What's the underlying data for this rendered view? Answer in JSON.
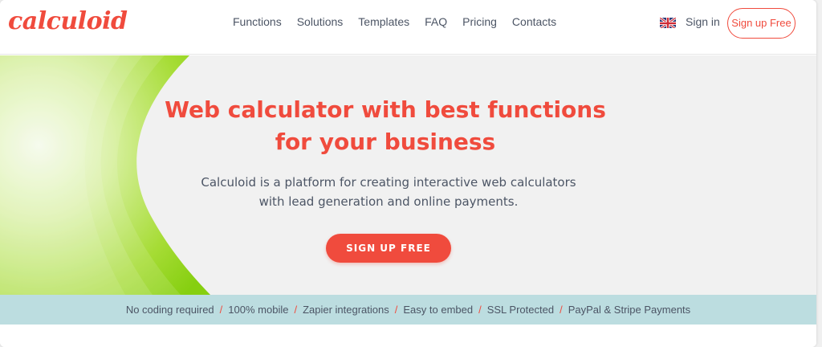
{
  "header": {
    "logo": "calculoid",
    "nav": [
      {
        "label": "Functions"
      },
      {
        "label": "Solutions"
      },
      {
        "label": "Templates"
      },
      {
        "label": "FAQ"
      },
      {
        "label": "Pricing"
      },
      {
        "label": "Contacts"
      }
    ],
    "sign_in": "Sign in",
    "sign_up": "Sign up Free"
  },
  "hero": {
    "title_line1": "Web calculator with best functions",
    "title_line2": "for your business",
    "subtitle_line1": "Calculoid is a platform for creating interactive web calculators",
    "subtitle_line2": "with lead generation and online payments.",
    "cta": "SIGN UP FREE"
  },
  "features": [
    "No coding required",
    "100% mobile",
    "Zapier integrations",
    "Easy to embed",
    "SSL Protected",
    "PayPal & Stripe Payments"
  ],
  "colors": {
    "brand": "#f04b3d",
    "text": "#4c5565",
    "green": "#8fd11a",
    "strip": "#bcdde0"
  },
  "icons": {
    "language": "uk-flag-icon"
  }
}
